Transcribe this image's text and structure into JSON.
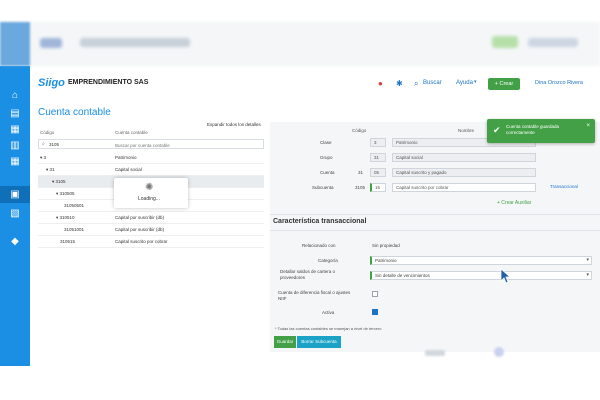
{
  "header": {
    "logo": "Siigo",
    "company": "EMPRENDIMIENTO SAS",
    "search_label": "Buscar",
    "help_label": "Ayuda",
    "create_label": "+ Crear",
    "user_name": "Dina Orozco Rivera"
  },
  "page": {
    "title": "Cuenta contable"
  },
  "tree": {
    "expand_all": "Expandir todos los detalles",
    "col_code": "Código",
    "col_name": "Cuenta contable",
    "search_value": "3105",
    "search_placeholder": "Buscar por cuenta contable",
    "rows": [
      {
        "code": "3",
        "name": "Patrimonio"
      },
      {
        "code": "31",
        "name": "Capital social"
      },
      {
        "code": "3105",
        "name": ""
      },
      {
        "code": "310505",
        "name": ""
      },
      {
        "code": "31050501",
        "name": ""
      },
      {
        "code": "310510",
        "name": "Capital por suscribir (db)"
      },
      {
        "code": "31051001",
        "name": "Capital por suscribir (db)"
      },
      {
        "code": "310515",
        "name": "Capital suscrito por cobrar"
      }
    ],
    "loading_text": "Loading..."
  },
  "detail": {
    "col_code": "Código",
    "col_name": "Nombre",
    "clase_label": "Clase",
    "clase_code": "3",
    "clase_name": "Patrimonio",
    "grupo_label": "Grupo",
    "grupo_code": "31",
    "grupo_name": "Capital social",
    "cuenta_label": "Cuenta",
    "cuenta_prefix": "31",
    "cuenta_code": "05",
    "cuenta_name": "Capital suscrito y pagado",
    "subcuenta_label": "Subcuenta",
    "subcuenta_prefix": "3105",
    "subcuenta_code": "15",
    "subcuenta_name": "Capital suscrito por cobrar",
    "transaccional_link": "Transaccional",
    "crear_auxiliar": "+ Crear Auxiliar",
    "section_title": "Característica transaccional",
    "relacionado_label": "Relacionado con",
    "relacionado_value": "Sin propiedad",
    "categoria_label": "Categoría",
    "categoria_value": "Patrimonio",
    "saldos_label": "Detallar saldos de cartera o proveedores",
    "saldos_value": "Sin detalle de vencimientos",
    "diferencia_label": "Cuenta de diferencia fiscal o ajustes NIIF",
    "activa_label": "Activa",
    "note": "* Todas las cuentas contables se manejan a nivel de tercero",
    "save_label": "Guardar",
    "delete_label": "Borrar Subcuenta"
  },
  "toast": {
    "message": "Cuenta contable guardada correctamente"
  },
  "colors": {
    "accent": "#1a8fe3",
    "success": "#43a047"
  }
}
